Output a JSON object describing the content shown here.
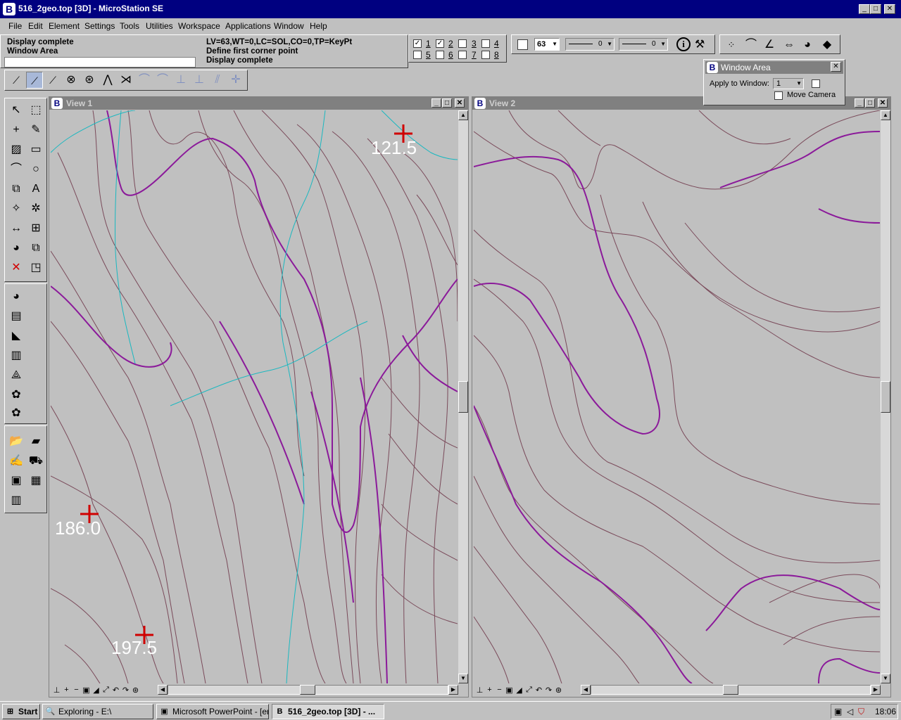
{
  "window": {
    "title": "516_2geo.top [3D] - MicroStation SE",
    "logo": "B"
  },
  "menu": [
    "File",
    "Edit",
    "Element",
    "Settings",
    "Tools",
    "Utilities",
    "Workspace",
    "Applications",
    "Window",
    "Help"
  ],
  "status": {
    "left1": "Display complete",
    "left2": "Window Area",
    "right1": "LV=63,WT=0,LC=SOL,CO=0,TP=KeyPt",
    "right2": "Define first corner point",
    "right3": "Display complete",
    "keyin_value": ""
  },
  "levels": [
    {
      "label": "1",
      "checked": true
    },
    {
      "label": "2",
      "checked": true
    },
    {
      "label": "3",
      "checked": false
    },
    {
      "label": "4",
      "checked": false
    },
    {
      "label": "5",
      "checked": false
    },
    {
      "label": "6",
      "checked": false
    },
    {
      "label": "7",
      "checked": false
    },
    {
      "label": "8",
      "checked": false
    }
  ],
  "attributes": {
    "color_value": "63",
    "style_value": "0",
    "weight_value": "0"
  },
  "dialog": {
    "title": "Window Area",
    "apply_label": "Apply to Window:",
    "apply_value": "1",
    "move_camera_label": "Move Camera"
  },
  "view1": {
    "title": "View 1",
    "labels": [
      {
        "text": "121.5"
      },
      {
        "text": "186.0"
      },
      {
        "text": "197.5"
      }
    ]
  },
  "view2": {
    "title": "View 2"
  },
  "colors": {
    "contour": "#7a4a5a",
    "index_contour": "#8b1a9a",
    "stream": "#1ab8c0",
    "marker": "#d00000",
    "titlebar": "#000080"
  },
  "taskbar": {
    "start": "Start",
    "tasks": [
      "Exploring - E:\\",
      "Microsoft PowerPoint - [err...",
      "516_2geo.top [3D] - ..."
    ],
    "clock": "18:06"
  }
}
